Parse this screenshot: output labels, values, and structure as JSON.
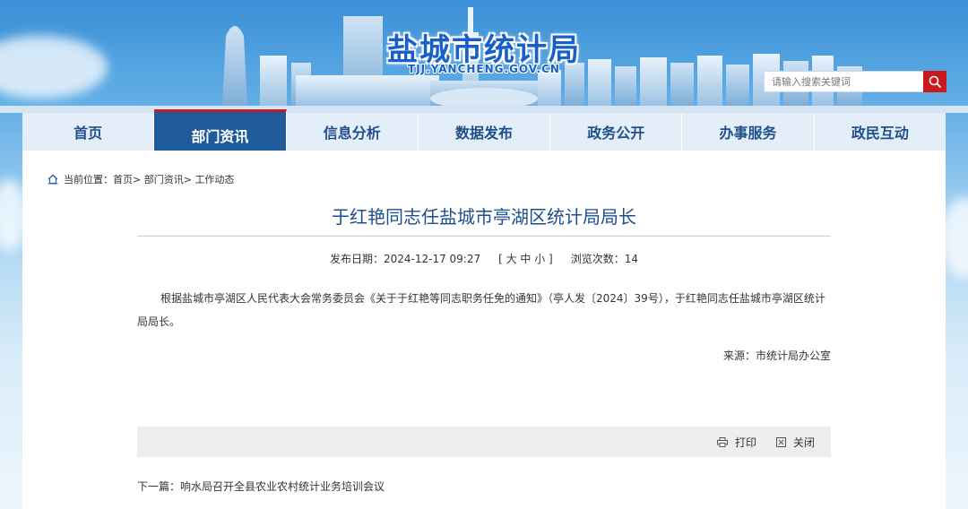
{
  "site": {
    "title": "盐城市统计局",
    "domain": "TJJ.YANCHENG.GOV.CN"
  },
  "search": {
    "placeholder": "请输入搜索关键词",
    "icon": "search-icon"
  },
  "nav": {
    "items": [
      {
        "label": "首页"
      },
      {
        "label": "部门资讯"
      },
      {
        "label": "信息分析"
      },
      {
        "label": "数据发布"
      },
      {
        "label": "政务公开"
      },
      {
        "label": "办事服务"
      },
      {
        "label": "政民互动"
      }
    ],
    "active_index": 1
  },
  "breadcrumb": {
    "prefix": "当前位置：",
    "items": [
      "首页",
      "部门资讯",
      "工作动态"
    ],
    "separator": ">"
  },
  "article": {
    "title": "于红艳同志任盐城市亭湖区统计局局长",
    "publish_label": "发布日期：",
    "publish_date": "2024-12-17 09:27",
    "font_size_label": "[ 大 中 小 ]",
    "views_label": "浏览次数：",
    "views": "14",
    "body": "根据盐城市亭湖区人民代表大会常务委员会《关于于红艳等同志职务任免的通知》（亭人发〔2024〕39号），于红艳同志任盐城市亭湖区统计局局长。",
    "source": "来源：市统计局办公室"
  },
  "tools": {
    "print_label": "打印",
    "close_label": "关闭"
  },
  "next": {
    "label": "下一篇：",
    "title": "响水局召开全县农业农村统计业务培训会议"
  },
  "colors": {
    "nav_active": "#1e5a9c",
    "accent_red": "#c91a20",
    "title_blue": "#1d4f8f",
    "nav_bg": "#e4eef8"
  }
}
